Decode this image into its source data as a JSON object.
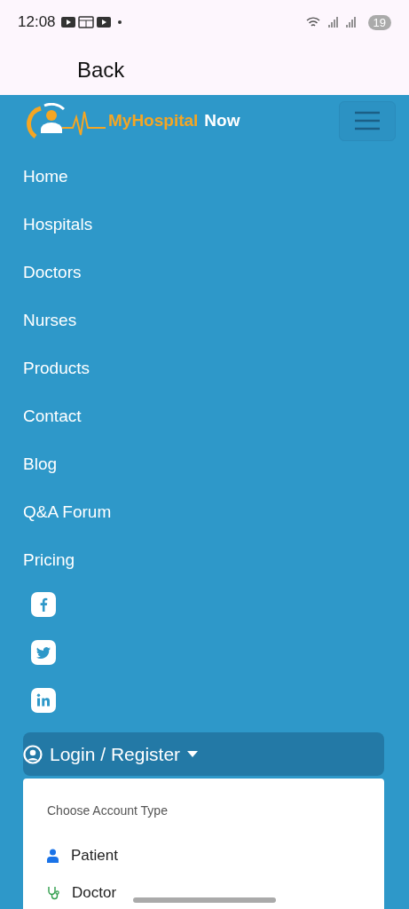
{
  "status_bar": {
    "time": "12:08",
    "battery": "19"
  },
  "app_bar": {
    "back": "Back"
  },
  "brand": {
    "name": "MyHospital",
    "suffix": "Now"
  },
  "nav_items": [
    {
      "label": "Home"
    },
    {
      "label": "Hospitals"
    },
    {
      "label": "Doctors"
    },
    {
      "label": "Nurses"
    },
    {
      "label": "Products"
    },
    {
      "label": "Contact"
    },
    {
      "label": "Blog"
    },
    {
      "label": "Q&A Forum"
    },
    {
      "label": "Pricing"
    }
  ],
  "social": [
    {
      "kind": "facebook"
    },
    {
      "kind": "twitter"
    },
    {
      "kind": "linkedin"
    }
  ],
  "login": {
    "label": "Login / Register",
    "expanded": true
  },
  "dropdown": {
    "header": "Choose Account Type",
    "items": [
      {
        "kind": "patient",
        "label": "Patient"
      },
      {
        "kind": "doctor",
        "label": "Doctor"
      }
    ]
  }
}
